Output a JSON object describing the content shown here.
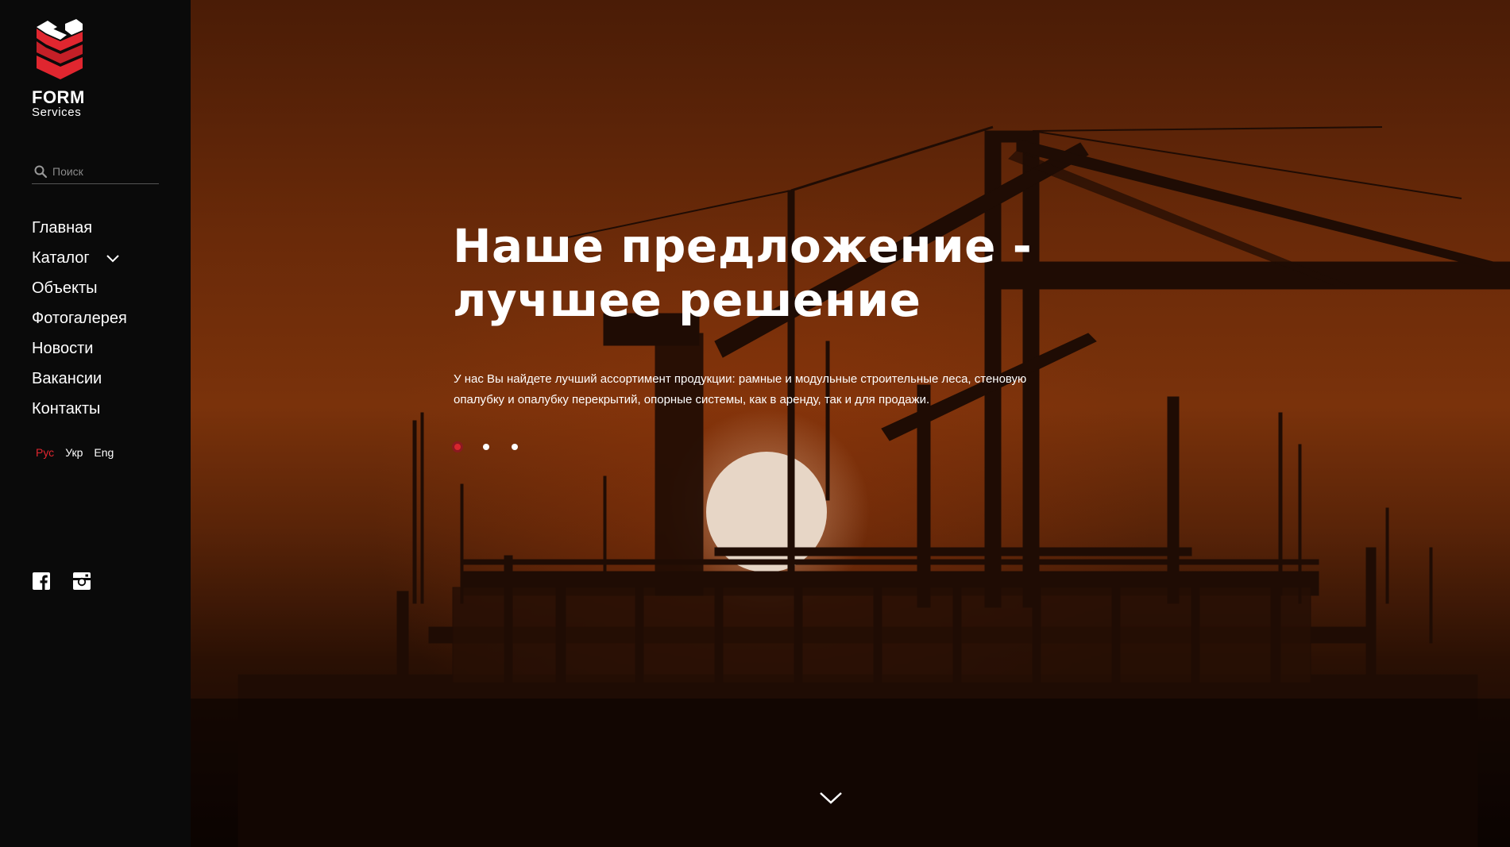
{
  "brand": {
    "name": "FORM",
    "subtitle": "Services",
    "colors": {
      "red": "#e0262f",
      "dark_red": "#b11b22"
    }
  },
  "search": {
    "placeholder": "Поиск",
    "value": ""
  },
  "nav": {
    "items": [
      {
        "label": "Главная"
      },
      {
        "label": "Каталог",
        "has_dropdown": true
      },
      {
        "label": "Объекты"
      },
      {
        "label": "Фотогалерея"
      },
      {
        "label": "Новости"
      },
      {
        "label": "Вакансии"
      },
      {
        "label": "Контакты"
      }
    ]
  },
  "languages": [
    {
      "label": "Рус",
      "active": true
    },
    {
      "label": "Укр",
      "active": false
    },
    {
      "label": "Eng",
      "active": false
    }
  ],
  "social": [
    "facebook-icon",
    "instagram-icon"
  ],
  "hero": {
    "title_line1": "Наше предложение -",
    "title_line2": "лучшее решение",
    "description_line1": "У нас Вы найдете лучший ассортимент продукции: рамные и модульные строительные леса, стеновую",
    "description_line2": "опалубку и опалубку перекрытий, опорные системы, как в аренду, так и для продажи.",
    "slides": {
      "count": 3,
      "active": 1
    }
  }
}
